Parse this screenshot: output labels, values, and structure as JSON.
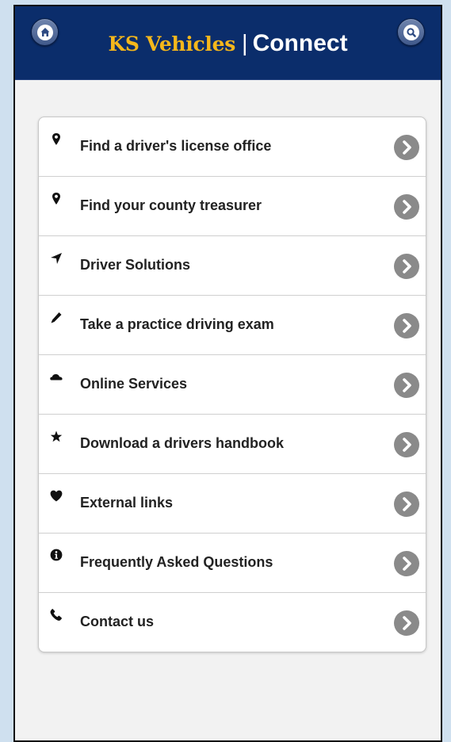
{
  "header": {
    "brand": "KS Vehicles",
    "separator": "|",
    "subtitle": "Connect",
    "brand_color": "#f5b71b",
    "bar_color": "#0b2d6b",
    "home_icon": "home-icon",
    "search_icon": "search-icon"
  },
  "menu": {
    "items": [
      {
        "label": "Find a driver's license office",
        "icon": "map-marker-icon"
      },
      {
        "label": "Find your county treasurer",
        "icon": "map-marker-icon"
      },
      {
        "label": "Driver Solutions",
        "icon": "location-arrow-icon"
      },
      {
        "label": "Take a practice driving exam",
        "icon": "pencil-icon"
      },
      {
        "label": "Online Services",
        "icon": "cloud-icon"
      },
      {
        "label": "Download a drivers handbook",
        "icon": "star-icon"
      },
      {
        "label": "External links",
        "icon": "heart-icon"
      },
      {
        "label": "Frequently Asked Questions",
        "icon": "info-icon"
      },
      {
        "label": "Contact us",
        "icon": "phone-icon"
      }
    ],
    "chevron_color": "#8a8a8a"
  }
}
